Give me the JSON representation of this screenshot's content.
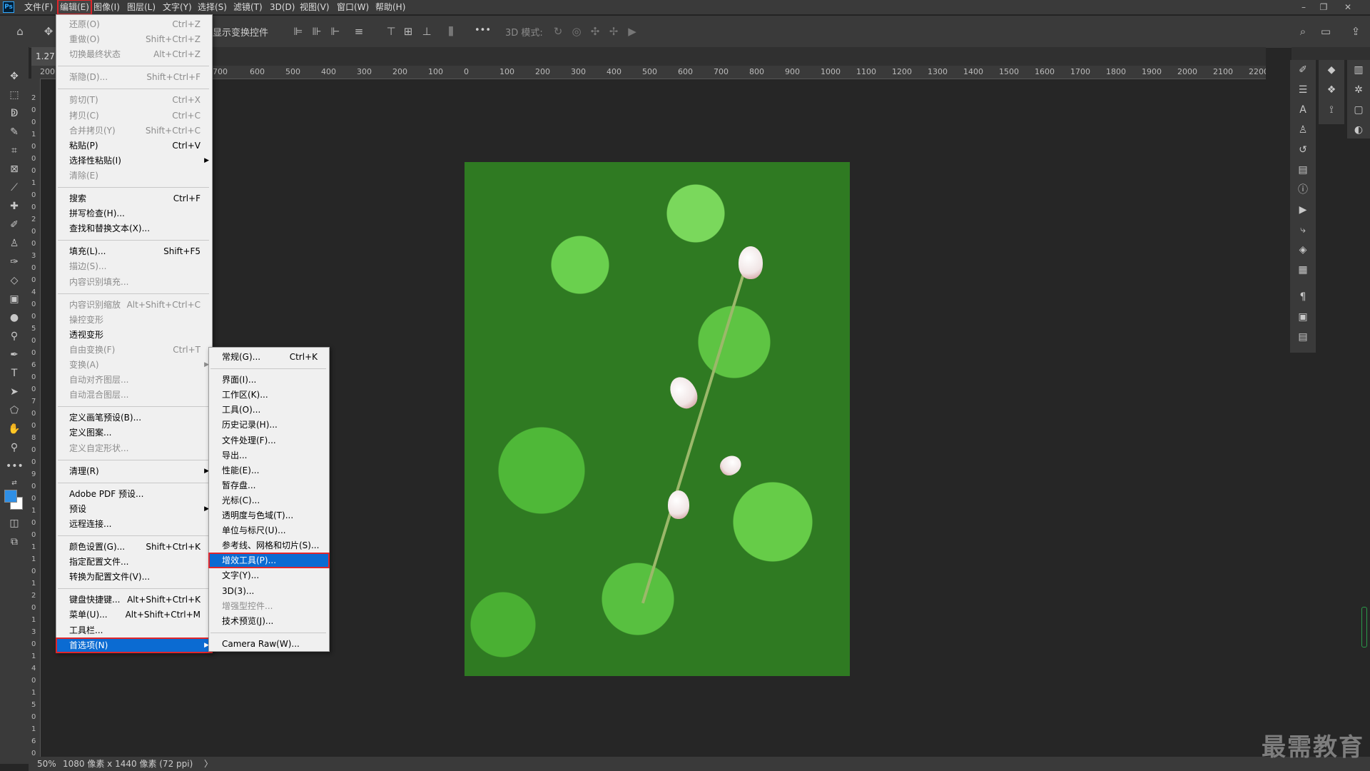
{
  "menubar": {
    "logo": "Ps",
    "items": [
      "文件(F)",
      "编辑(E)",
      "图像(I)",
      "图层(L)",
      "文字(Y)",
      "选择(S)",
      "滤镜(T)",
      "3D(D)",
      "视图(V)",
      "窗口(W)",
      "帮助(H)"
    ]
  },
  "optionsbar": {
    "transform_controls": "显示变换控件",
    "mode_3d": "3D 模式:",
    "more": "•••"
  },
  "document": {
    "tab_label": "1.27"
  },
  "ruler": {
    "h_ticks": [
      "200",
      "700",
      "600",
      "500",
      "400",
      "300",
      "200",
      "100",
      "0",
      "100",
      "200",
      "300",
      "400",
      "500",
      "600",
      "700",
      "800",
      "900",
      "1000",
      "1100",
      "1200",
      "1300",
      "1400",
      "1500",
      "1600",
      "1700",
      "1800",
      "1900",
      "2000",
      "2100",
      "2200"
    ],
    "v_ticks": [
      "2",
      "0",
      "0",
      "1",
      "0",
      "0",
      "0",
      "1",
      "0",
      "0",
      "2",
      "0",
      "0",
      "3",
      "0",
      "0",
      "4",
      "0",
      "0",
      "5",
      "0",
      "0",
      "6",
      "0",
      "0",
      "7",
      "0",
      "0",
      "8",
      "0",
      "0",
      "9",
      "0",
      "0",
      "1",
      "0",
      "0",
      "1",
      "1",
      "0",
      "1",
      "2",
      "0",
      "1",
      "3",
      "0",
      "1",
      "4",
      "0",
      "1",
      "5",
      "0",
      "1",
      "6",
      "0"
    ]
  },
  "edit_menu": {
    "items": [
      {
        "label": "还原(O)",
        "shortcut": "Ctrl+Z",
        "disabled": true
      },
      {
        "label": "重做(O)",
        "shortcut": "Shift+Ctrl+Z",
        "disabled": true
      },
      {
        "label": "切换最终状态",
        "shortcut": "Alt+Ctrl+Z",
        "disabled": true
      },
      {
        "sep": true
      },
      {
        "label": "渐隐(D)...",
        "shortcut": "Shift+Ctrl+F",
        "disabled": true
      },
      {
        "sep": true
      },
      {
        "label": "剪切(T)",
        "shortcut": "Ctrl+X",
        "disabled": true
      },
      {
        "label": "拷贝(C)",
        "shortcut": "Ctrl+C",
        "disabled": true
      },
      {
        "label": "合并拷贝(Y)",
        "shortcut": "Shift+Ctrl+C",
        "disabled": true
      },
      {
        "label": "粘贴(P)",
        "shortcut": "Ctrl+V",
        "disabled": false
      },
      {
        "label": "选择性粘贴(I)",
        "shortcut": "",
        "disabled": false,
        "submenu": true
      },
      {
        "label": "清除(E)",
        "shortcut": "",
        "disabled": true
      },
      {
        "sep": true
      },
      {
        "label": "搜索",
        "shortcut": "Ctrl+F",
        "disabled": false
      },
      {
        "label": "拼写检查(H)...",
        "shortcut": "",
        "disabled": false
      },
      {
        "label": "查找和替换文本(X)...",
        "shortcut": "",
        "disabled": false
      },
      {
        "sep": true
      },
      {
        "label": "填充(L)...",
        "shortcut": "Shift+F5",
        "disabled": false
      },
      {
        "label": "描边(S)...",
        "shortcut": "",
        "disabled": true
      },
      {
        "label": "内容识别填充...",
        "shortcut": "",
        "disabled": true
      },
      {
        "sep": true
      },
      {
        "label": "内容识别缩放",
        "shortcut": "Alt+Shift+Ctrl+C",
        "disabled": true
      },
      {
        "label": "操控变形",
        "shortcut": "",
        "disabled": true
      },
      {
        "label": "透视变形",
        "shortcut": "",
        "disabled": false
      },
      {
        "label": "自由变换(F)",
        "shortcut": "Ctrl+T",
        "disabled": true
      },
      {
        "label": "变换(A)",
        "shortcut": "",
        "disabled": true,
        "submenu": true
      },
      {
        "label": "自动对齐图层...",
        "shortcut": "",
        "disabled": true
      },
      {
        "label": "自动混合图层...",
        "shortcut": "",
        "disabled": true
      },
      {
        "sep": true
      },
      {
        "label": "定义画笔预设(B)...",
        "shortcut": "",
        "disabled": false
      },
      {
        "label": "定义图案...",
        "shortcut": "",
        "disabled": false
      },
      {
        "label": "定义自定形状...",
        "shortcut": "",
        "disabled": true
      },
      {
        "sep": true
      },
      {
        "label": "清理(R)",
        "shortcut": "",
        "disabled": false,
        "submenu": true
      },
      {
        "sep": true
      },
      {
        "label": "Adobe PDF 预设...",
        "shortcut": "",
        "disabled": false
      },
      {
        "label": "预设",
        "shortcut": "",
        "disabled": false,
        "submenu": true
      },
      {
        "label": "远程连接...",
        "shortcut": "",
        "disabled": false
      },
      {
        "sep": true
      },
      {
        "label": "颜色设置(G)...",
        "shortcut": "Shift+Ctrl+K",
        "disabled": false
      },
      {
        "label": "指定配置文件...",
        "shortcut": "",
        "disabled": false
      },
      {
        "label": "转换为配置文件(V)...",
        "shortcut": "",
        "disabled": false
      },
      {
        "sep": true
      },
      {
        "label": "键盘快捷键...",
        "shortcut": "Alt+Shift+Ctrl+K",
        "disabled": false
      },
      {
        "label": "菜单(U)...",
        "shortcut": "Alt+Shift+Ctrl+M",
        "disabled": false
      },
      {
        "label": "工具栏...",
        "shortcut": "",
        "disabled": false
      },
      {
        "label": "首选项(N)",
        "shortcut": "",
        "disabled": false,
        "submenu": true,
        "highlighted": true
      }
    ]
  },
  "prefs_menu": {
    "items": [
      {
        "label": "常规(G)...",
        "shortcut": "Ctrl+K",
        "disabled": false
      },
      {
        "sep": true
      },
      {
        "label": "界面(I)...",
        "shortcut": "",
        "disabled": false
      },
      {
        "label": "工作区(K)...",
        "shortcut": "",
        "disabled": false
      },
      {
        "label": "工具(O)...",
        "shortcut": "",
        "disabled": false
      },
      {
        "label": "历史记录(H)...",
        "shortcut": "",
        "disabled": false
      },
      {
        "label": "文件处理(F)...",
        "shortcut": "",
        "disabled": false
      },
      {
        "label": "导出...",
        "shortcut": "",
        "disabled": false
      },
      {
        "label": "性能(E)...",
        "shortcut": "",
        "disabled": false
      },
      {
        "label": "暂存盘...",
        "shortcut": "",
        "disabled": false
      },
      {
        "label": "光标(C)...",
        "shortcut": "",
        "disabled": false
      },
      {
        "label": "透明度与色域(T)...",
        "shortcut": "",
        "disabled": false
      },
      {
        "label": "单位与标尺(U)...",
        "shortcut": "",
        "disabled": false
      },
      {
        "label": "参考线、网格和切片(S)...",
        "shortcut": "",
        "disabled": false
      },
      {
        "label": "增效工具(P)...",
        "shortcut": "",
        "disabled": false,
        "highlighted": true
      },
      {
        "label": "文字(Y)...",
        "shortcut": "",
        "disabled": false
      },
      {
        "label": "3D(3)...",
        "shortcut": "",
        "disabled": false
      },
      {
        "label": "增强型控件...",
        "shortcut": "",
        "disabled": true
      },
      {
        "label": "技术预览(J)...",
        "shortcut": "",
        "disabled": false
      },
      {
        "sep": true
      },
      {
        "label": "Camera Raw(W)...",
        "shortcut": "",
        "disabled": false
      }
    ]
  },
  "status": {
    "zoom": "50%",
    "info": "1080 像素 x 1440 像素 (72 ppi)",
    "arrow": "〉"
  },
  "watermark": "最需教育",
  "colors": {
    "accent": "#0b6bd2",
    "highlight_border": "#e0262b",
    "foreground_swatch": "#2f8fe6",
    "background_swatch": "#ffffff"
  }
}
